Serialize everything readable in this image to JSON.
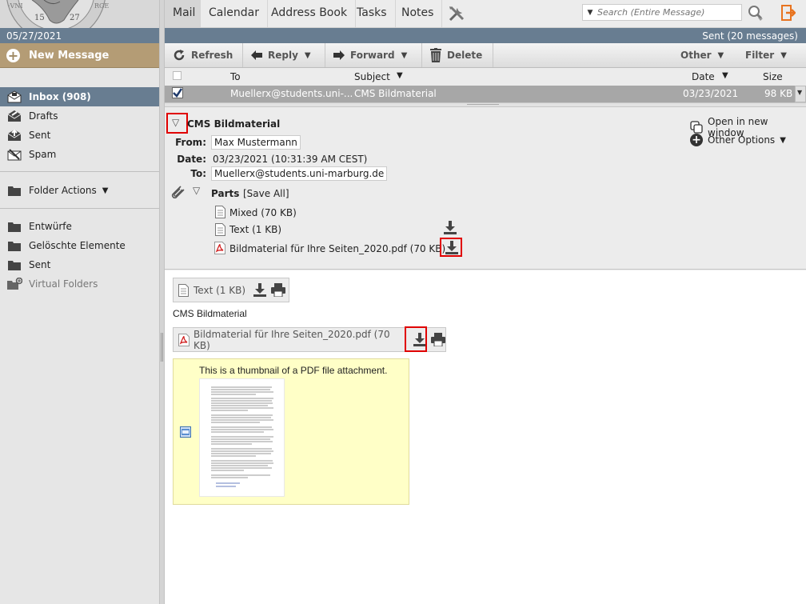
{
  "sidebar": {
    "date": "05/27/2021",
    "new_message": "New Message",
    "folders": [
      {
        "label": "Inbox (908)",
        "icon": "inbox-icon"
      },
      {
        "label": "Drafts",
        "icon": "drafts-icon"
      },
      {
        "label": "Sent",
        "icon": "sent-icon"
      },
      {
        "label": "Spam",
        "icon": "spam-icon"
      }
    ],
    "folder_actions": "Folder Actions",
    "extra_folders": [
      {
        "label": "Entwürfe"
      },
      {
        "label": "Gelöschte Elemente"
      },
      {
        "label": "Sent"
      },
      {
        "label": "Virtual Folders"
      }
    ],
    "logo_numbers": [
      "15",
      "27"
    ]
  },
  "nav": {
    "tabs": [
      "Mail",
      "Calendar",
      "Address Book",
      "Tasks",
      "Notes"
    ],
    "search_placeholder": "Search (Entire Message)"
  },
  "status": "Sent (20 messages)",
  "toolbar": {
    "refresh": "Refresh",
    "reply": "Reply",
    "forward": "Forward",
    "delete": "Delete",
    "other": "Other",
    "filter": "Filter"
  },
  "list": {
    "headers": {
      "to": "To",
      "subject": "Subject",
      "date": "Date",
      "size": "Size"
    },
    "row": {
      "to": "Muellerx@students.uni-...",
      "subject": "CMS Bildmaterial",
      "date": "03/23/2021",
      "size": "98 KB"
    }
  },
  "message": {
    "subject": "CMS Bildmaterial",
    "from_label": "From:",
    "from": "Max Mustermann",
    "date_label": "Date:",
    "date": "03/23/2021 (10:31:39 AM CEST)",
    "to_label": "To:",
    "to": "Muellerx@students.uni-marburg.de",
    "parts_label": "Parts",
    "save_all": "[Save All]",
    "parts": [
      "Mixed (70 KB)",
      "Text (1 KB)",
      "Bildmaterial für Ihre Seiten_2020.pdf (70 KB)"
    ],
    "open_new_window": "Open in new window",
    "other_options": "Other Options"
  },
  "body": {
    "text_attachment": "Text (1 KB)",
    "body_text": "CMS Bildmaterial",
    "pdf_attachment": "Bildmaterial für Ihre Seiten_2020.pdf (70 KB)",
    "thumb_caption": "This is a thumbnail of a PDF file attachment."
  },
  "colors": {
    "accent_bar": "#687d91",
    "new_message_bg": "#b49c75",
    "selected_row": "#a7a7a7",
    "pdf_red": "#d11f1f",
    "highlight_red": "#e00000",
    "thumbnail_bg": "#ffffc7",
    "logout_orange": "#e8731f"
  }
}
